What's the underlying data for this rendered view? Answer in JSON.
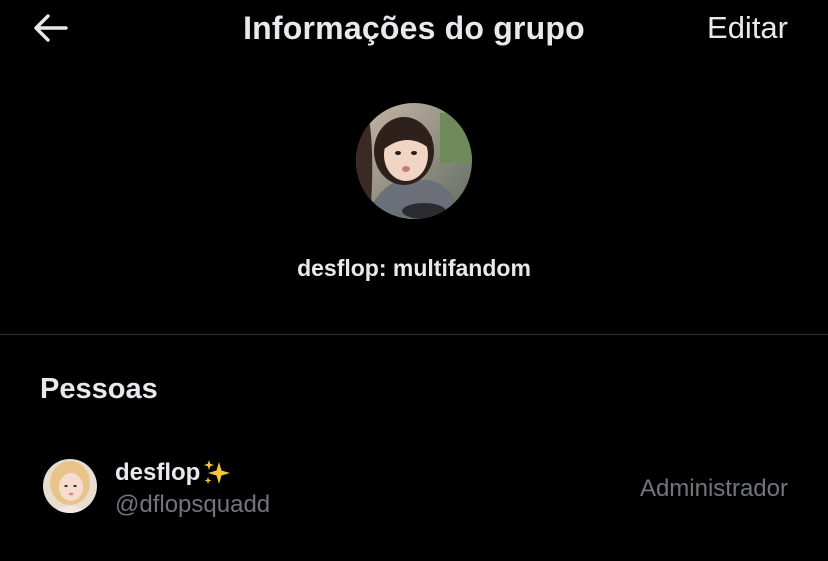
{
  "header": {
    "back_icon": "arrow-left-icon",
    "title": "Informações do grupo",
    "edit_label": "Editar"
  },
  "group": {
    "name": "desflop: multifandom"
  },
  "people": {
    "section_title": "Pessoas",
    "members": [
      {
        "display_name": "desflop",
        "badge_icon": "sparkles-icon",
        "handle": "@dflopsquadd",
        "role": "Administrador"
      }
    ]
  },
  "colors": {
    "background": "#000000",
    "primary_text": "#e7e9ea",
    "secondary_text": "#71767b",
    "divider": "#2f3336",
    "sparkle": "#f5c63c"
  }
}
